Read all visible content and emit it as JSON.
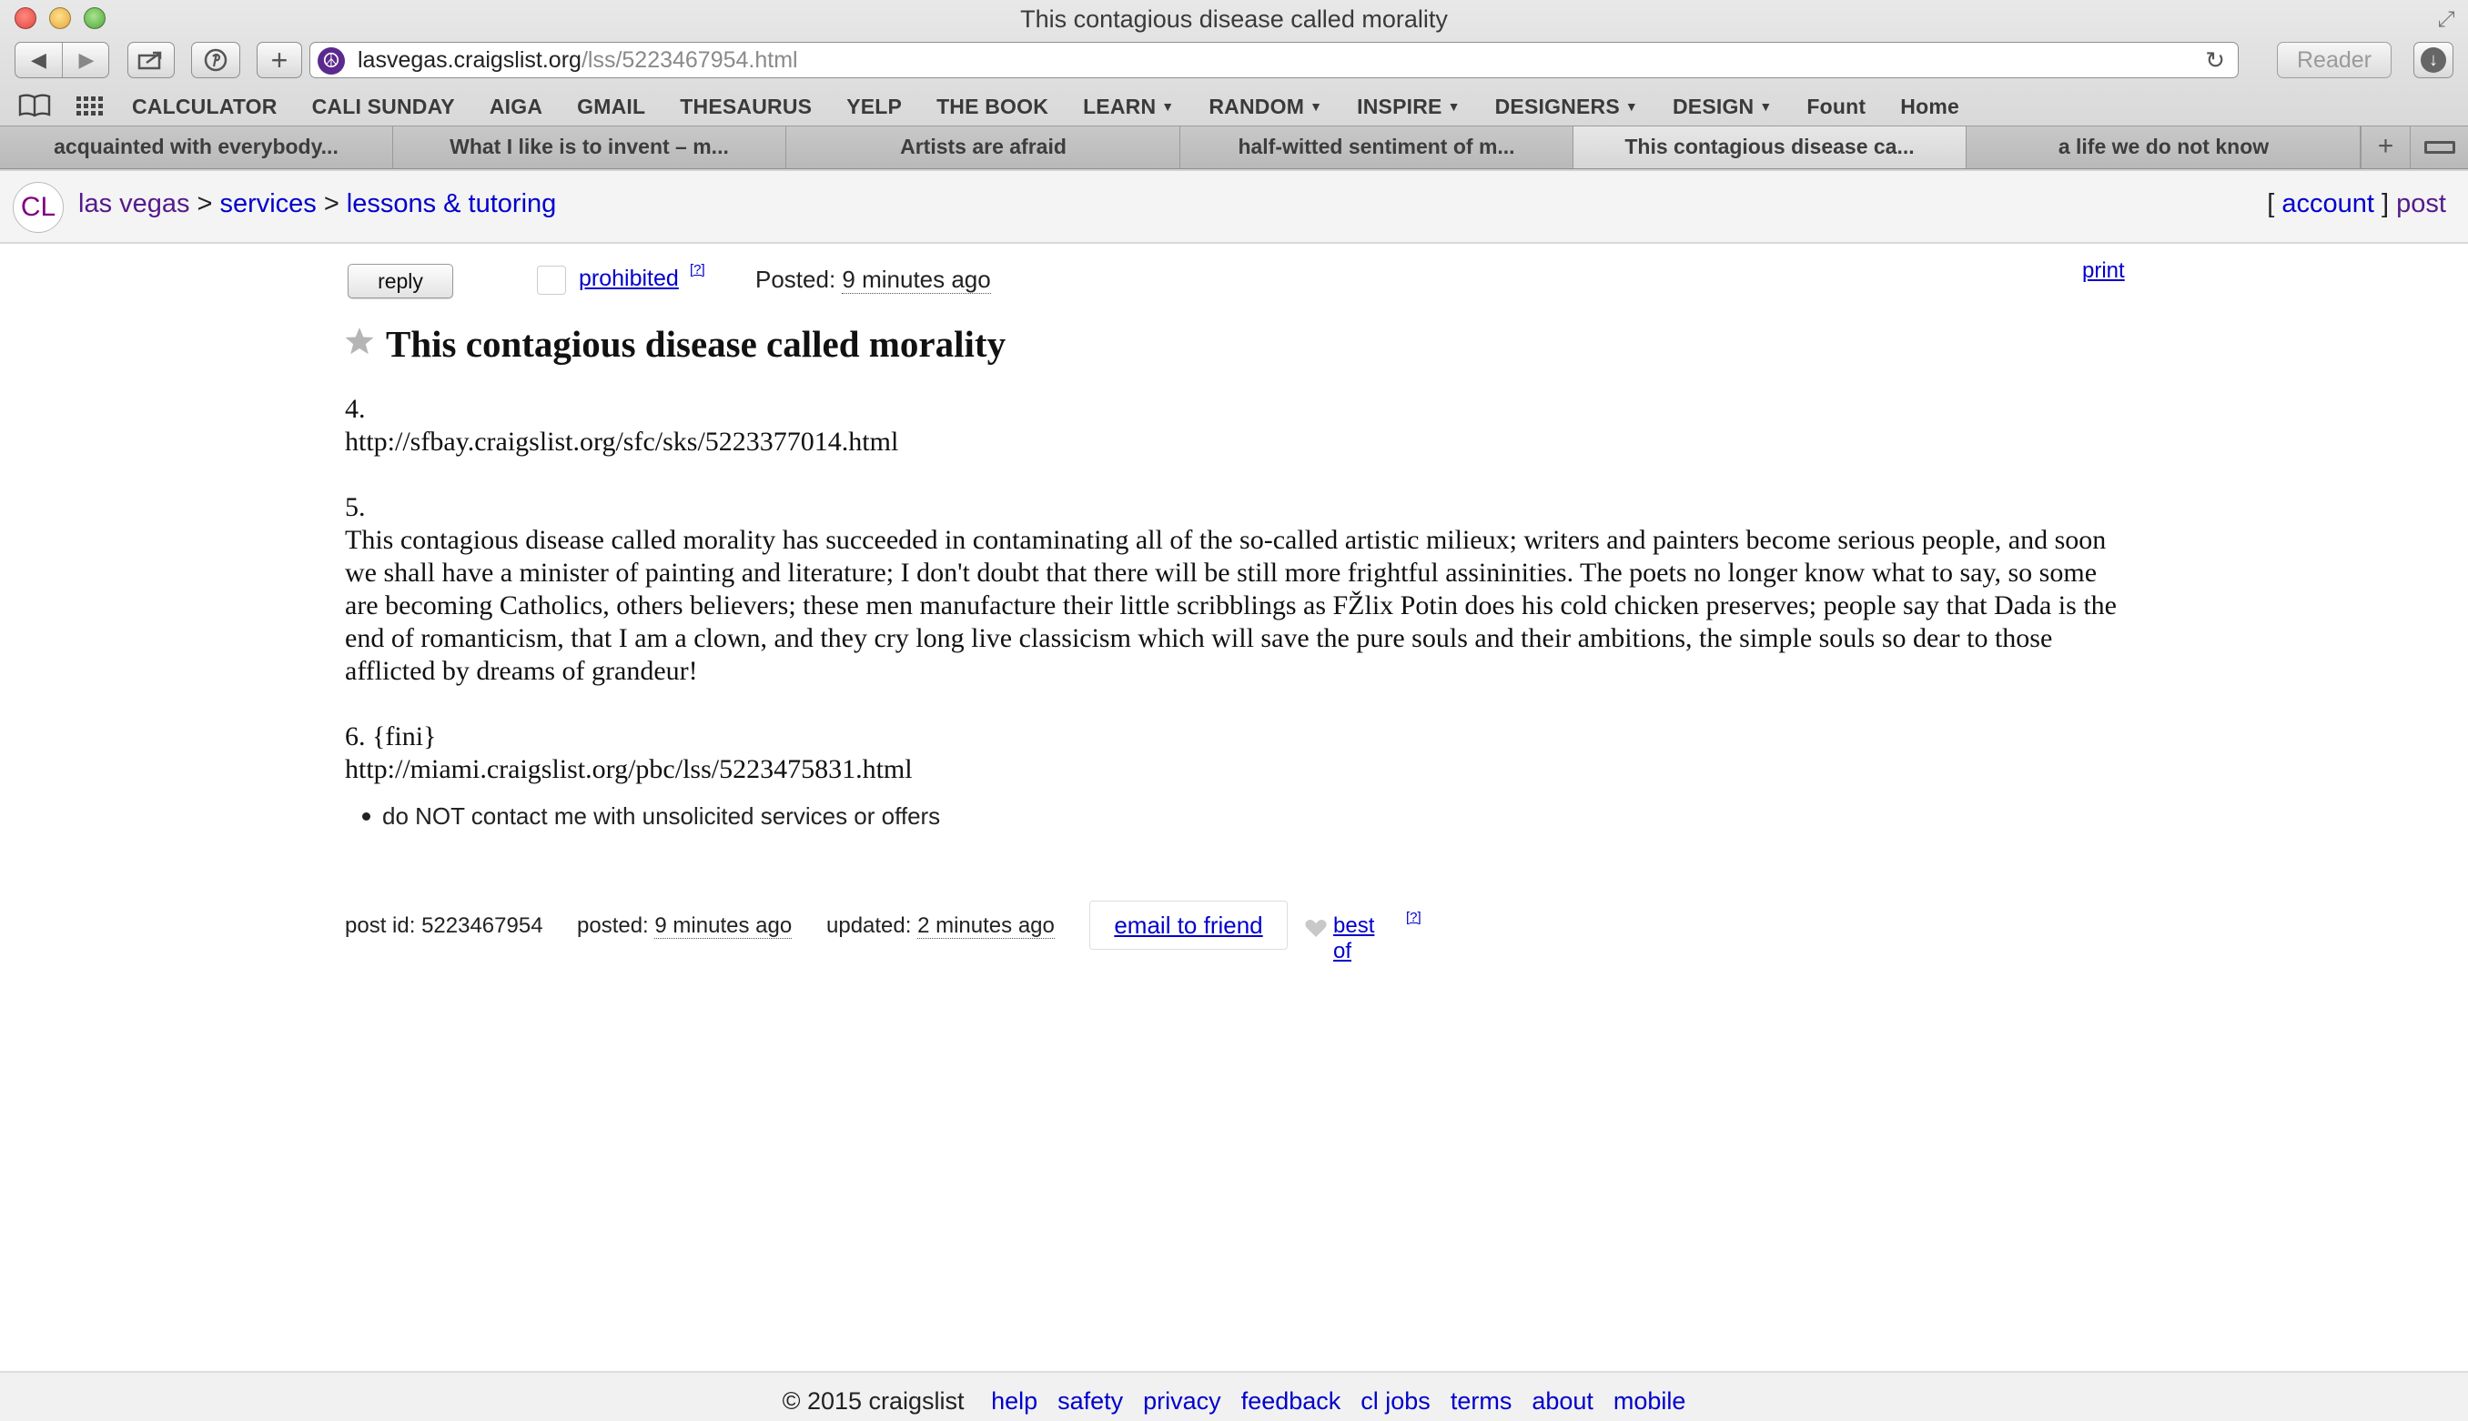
{
  "window": {
    "title": "This contagious disease called morality"
  },
  "browser": {
    "url_host": "lasvegas.craigslist.org",
    "url_path": "/lss/5223467954.html",
    "reader_label": "Reader",
    "bookmarks": [
      {
        "label": "CALCULATOR",
        "menu": false
      },
      {
        "label": "CALI SUNDAY",
        "menu": false
      },
      {
        "label": "AIGA",
        "menu": false
      },
      {
        "label": "GMAIL",
        "menu": false
      },
      {
        "label": "THESAURUS",
        "menu": false
      },
      {
        "label": "YELP",
        "menu": false
      },
      {
        "label": "THE BOOK",
        "menu": false
      },
      {
        "label": "LEARN",
        "menu": true
      },
      {
        "label": "RANDOM",
        "menu": true
      },
      {
        "label": "INSPIRE",
        "menu": true
      },
      {
        "label": "DESIGNERS",
        "menu": true
      },
      {
        "label": "DESIGN",
        "menu": true
      },
      {
        "label": "Fount",
        "menu": false
      },
      {
        "label": "Home",
        "menu": false
      }
    ],
    "tabs": [
      {
        "label": "acquainted with everybody...",
        "active": false
      },
      {
        "label": "What I like is to invent – m...",
        "active": false
      },
      {
        "label": "Artists are afraid",
        "active": false
      },
      {
        "label": "half-witted sentiment of m...",
        "active": false
      },
      {
        "label": "This contagious disease ca...",
        "active": true
      },
      {
        "label": "a life we do not know",
        "active": false
      }
    ]
  },
  "header": {
    "logo": "CL",
    "breadcrumb": {
      "city": "las vegas",
      "section": "services",
      "category": "lessons & tutoring",
      "sep": ">"
    },
    "account_open": "[",
    "account_label": "account",
    "account_close": "]",
    "post_label": "post"
  },
  "postingbar": {
    "reply_label": "reply",
    "prohibited_label": "prohibited",
    "help_label": "[?]",
    "posted_prefix": "Posted:",
    "posted_value": "9 minutes ago",
    "print_label": "print"
  },
  "posting": {
    "title": "This contagious disease called morality",
    "body": {
      "line1": "4.",
      "line2": "http://sfbay.craigslist.org/sfc/sks/5223377014.html",
      "line3": "5.",
      "paragraph": "This contagious disease called morality has succeeded in contaminating all of the so-called artistic milieux; writers and painters become serious people, and soon we shall have a minister of painting and literature; I don't doubt that there will be still more frightful assininities. The poets no longer know what to say, so some are becoming Catholics, others believers; these men manufacture their little scribblings as FŽlix Potin does his cold chicken preserves; people say that Dada is the end of romanticism, that I am a clown, and they cry long live classicism which will save the pure souls and their ambitions, the simple souls so dear to those afflicted by dreams of grandeur!",
      "line4": "6. {fini}",
      "line5": "http://miami.craigslist.org/pbc/lss/5223475831.html"
    },
    "notice": "do NOT contact me with unsolicited services or offers"
  },
  "postinfo": {
    "post_id_label": "post id:",
    "post_id": "5223467954",
    "posted_label": "posted:",
    "posted_value": "9 minutes ago",
    "updated_label": "updated:",
    "updated_value": "2 minutes ago",
    "email_label": "email to friend",
    "bestof_label": "best of",
    "help_label": "[?]"
  },
  "footer": {
    "copyright": "© 2015 craigslist",
    "links": [
      "help",
      "safety",
      "privacy",
      "feedback",
      "cl jobs",
      "terms",
      "about",
      "mobile"
    ]
  },
  "colors": {
    "link": "#0000cc",
    "visited": "#551a8b",
    "logo": "#800080"
  }
}
